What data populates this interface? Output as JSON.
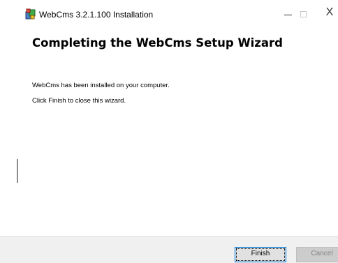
{
  "window": {
    "title": "WebCms 3.2.1.100 Installation",
    "controls": {
      "minimize_icon": "minimize-icon",
      "maximize_icon": "maximize-icon",
      "close_icon": "close-icon",
      "close_glyph": "X"
    },
    "app_icon": "installer-package-icon"
  },
  "content": {
    "heading": "Completing the WebCms Setup Wizard",
    "line1": "WebCms has been installed on your computer.",
    "line2": "Click Finish to close this wizard."
  },
  "footer": {
    "finish_label": "Finish",
    "cancel_label": "Cancel",
    "cancel_enabled": false
  },
  "colors": {
    "footer_bg": "#f0f0f0",
    "focus_border": "#0078d7",
    "disabled_text": "#838383"
  }
}
